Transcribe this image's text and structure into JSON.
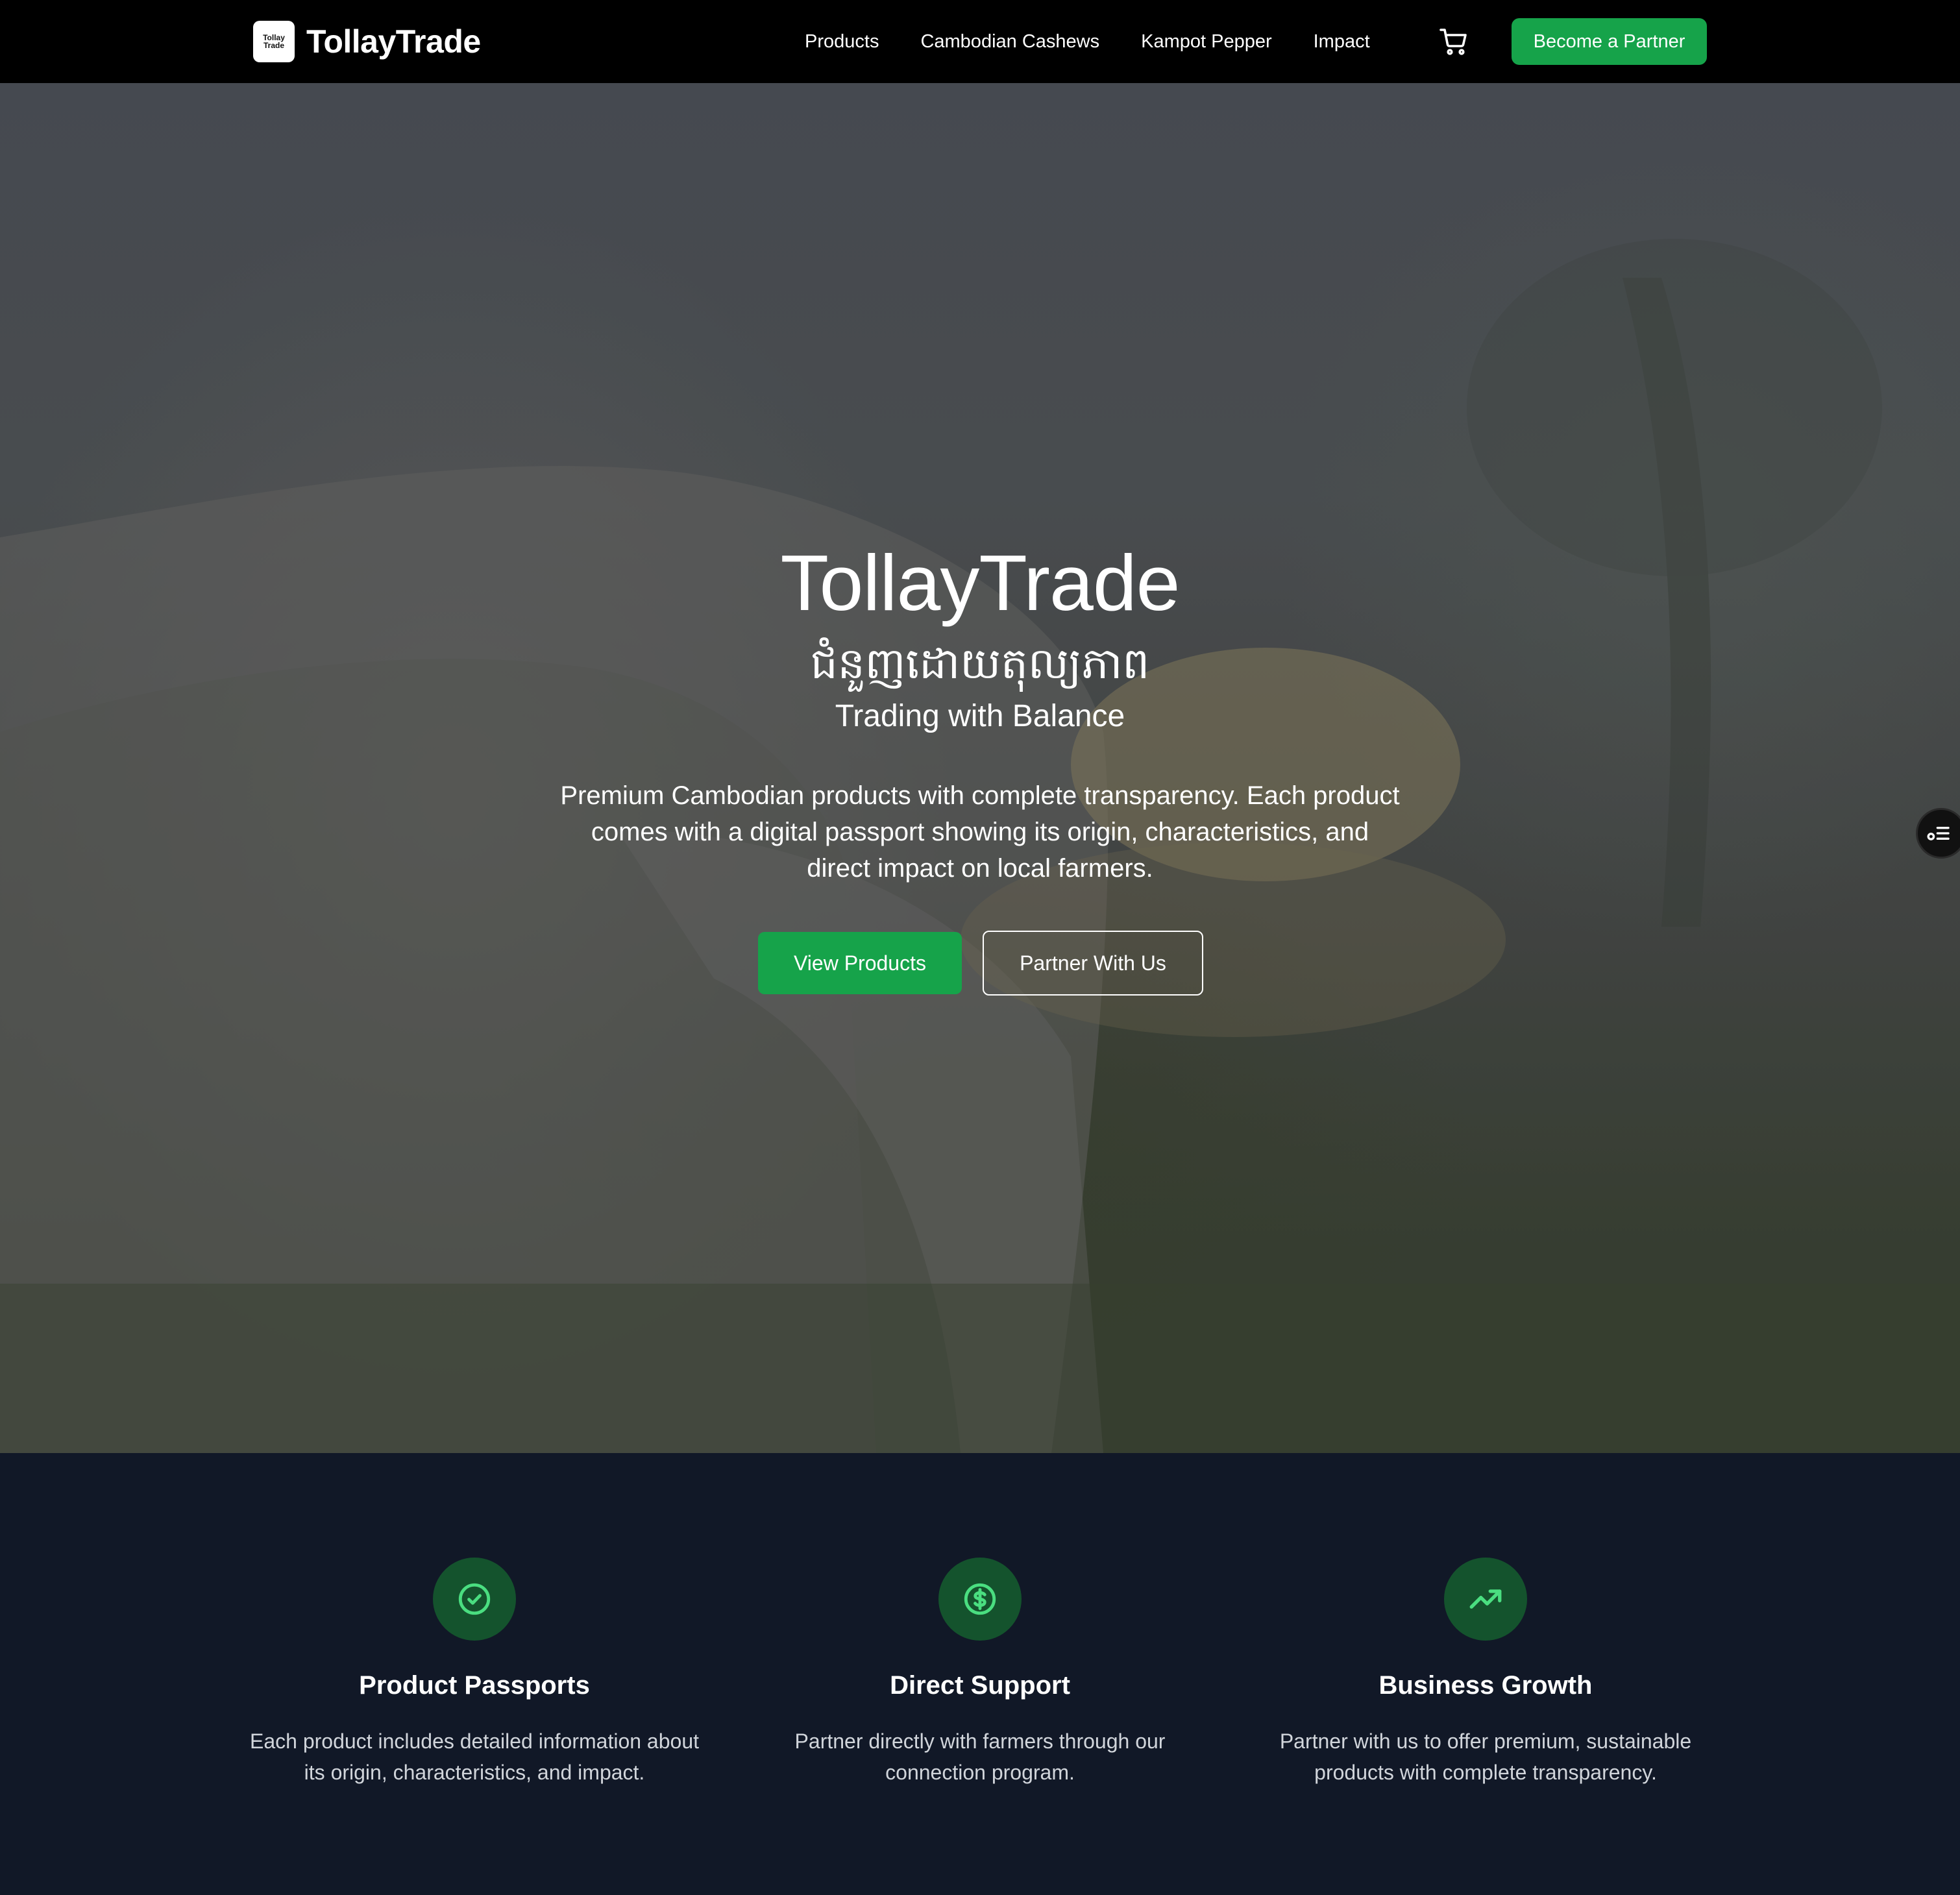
{
  "nav": {
    "brand": "TollayTrade",
    "logo_line1": "Tollay",
    "logo_line2": "Trade",
    "links": [
      "Products",
      "Cambodian Cashews",
      "Kampot Pepper",
      "Impact"
    ],
    "cart_icon": "cart-icon",
    "cta": "Become a Partner"
  },
  "hero": {
    "title": "TollayTrade",
    "khmer": "ជំនួញដោយតុល្យភាព",
    "tagline": "Trading with Balance",
    "description": "Premium Cambodian products with complete transparency. Each product comes with a digital passport showing its origin, characteristics, and direct impact on local farmers.",
    "primary_button": "View Products",
    "secondary_button": "Partner With Us"
  },
  "features": [
    {
      "icon": "check-circle-icon",
      "title": "Product Passports",
      "description": "Each product includes detailed information about its origin, characteristics, and impact."
    },
    {
      "icon": "dollar-circle-icon",
      "title": "Direct Support",
      "description": "Partner directly with farmers through our connection program."
    },
    {
      "icon": "trending-up-icon",
      "title": "Business Growth",
      "description": "Partner with us to offer premium, sustainable products with complete transparency."
    }
  ],
  "colors": {
    "accent": "#16a34a",
    "icon_bg": "#14532d",
    "icon_fg": "#4ade80",
    "footer_bg": "#111827",
    "nav_bg": "#000000"
  }
}
